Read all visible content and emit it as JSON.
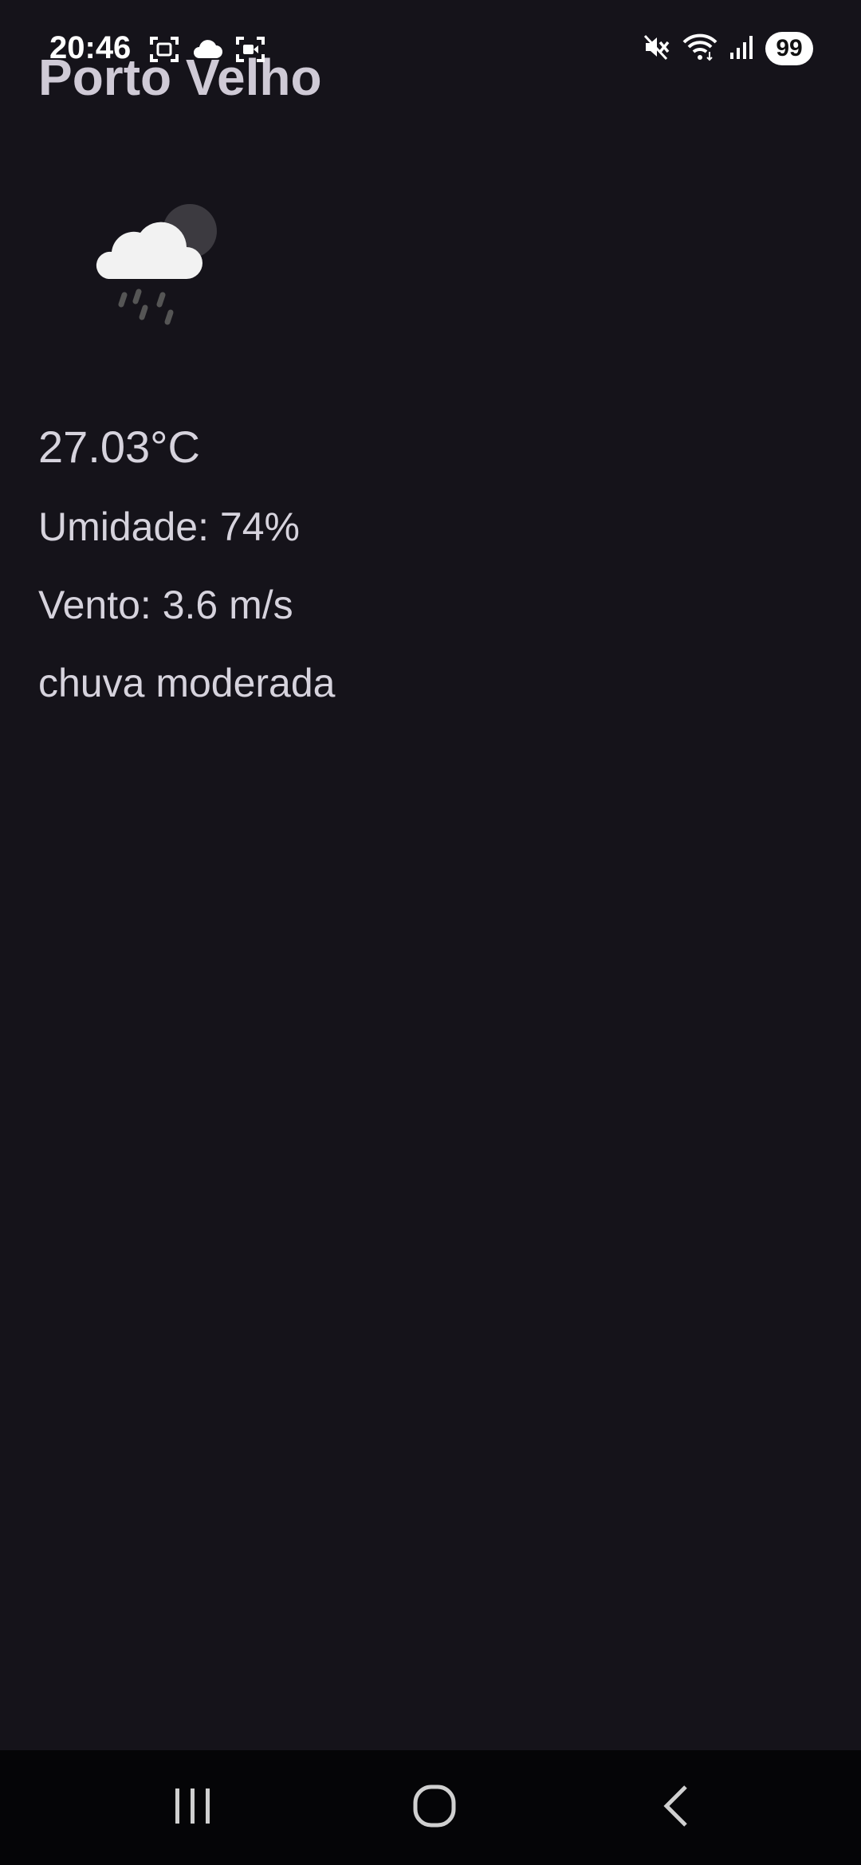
{
  "status_bar": {
    "time": "20:46",
    "battery": "99",
    "left_icons": [
      "screenshot-icon",
      "cloud-icon",
      "screen-record-icon"
    ],
    "right_icons": [
      "mute-icon",
      "wifi-icon",
      "signal-icon"
    ]
  },
  "weather": {
    "city": "Porto Velho",
    "icon": "cloud-rain-night-icon",
    "temperature": "27.03°C",
    "humidity": "Umidade: 74%",
    "wind": "Vento: 3.6 m/s",
    "description": "chuva moderada"
  },
  "nav_bar": {
    "buttons": [
      "recents-icon",
      "home-icon",
      "back-icon"
    ]
  },
  "colors": {
    "background": "#15131a",
    "text": "#d6d3dd",
    "nav_background": "#050507"
  }
}
